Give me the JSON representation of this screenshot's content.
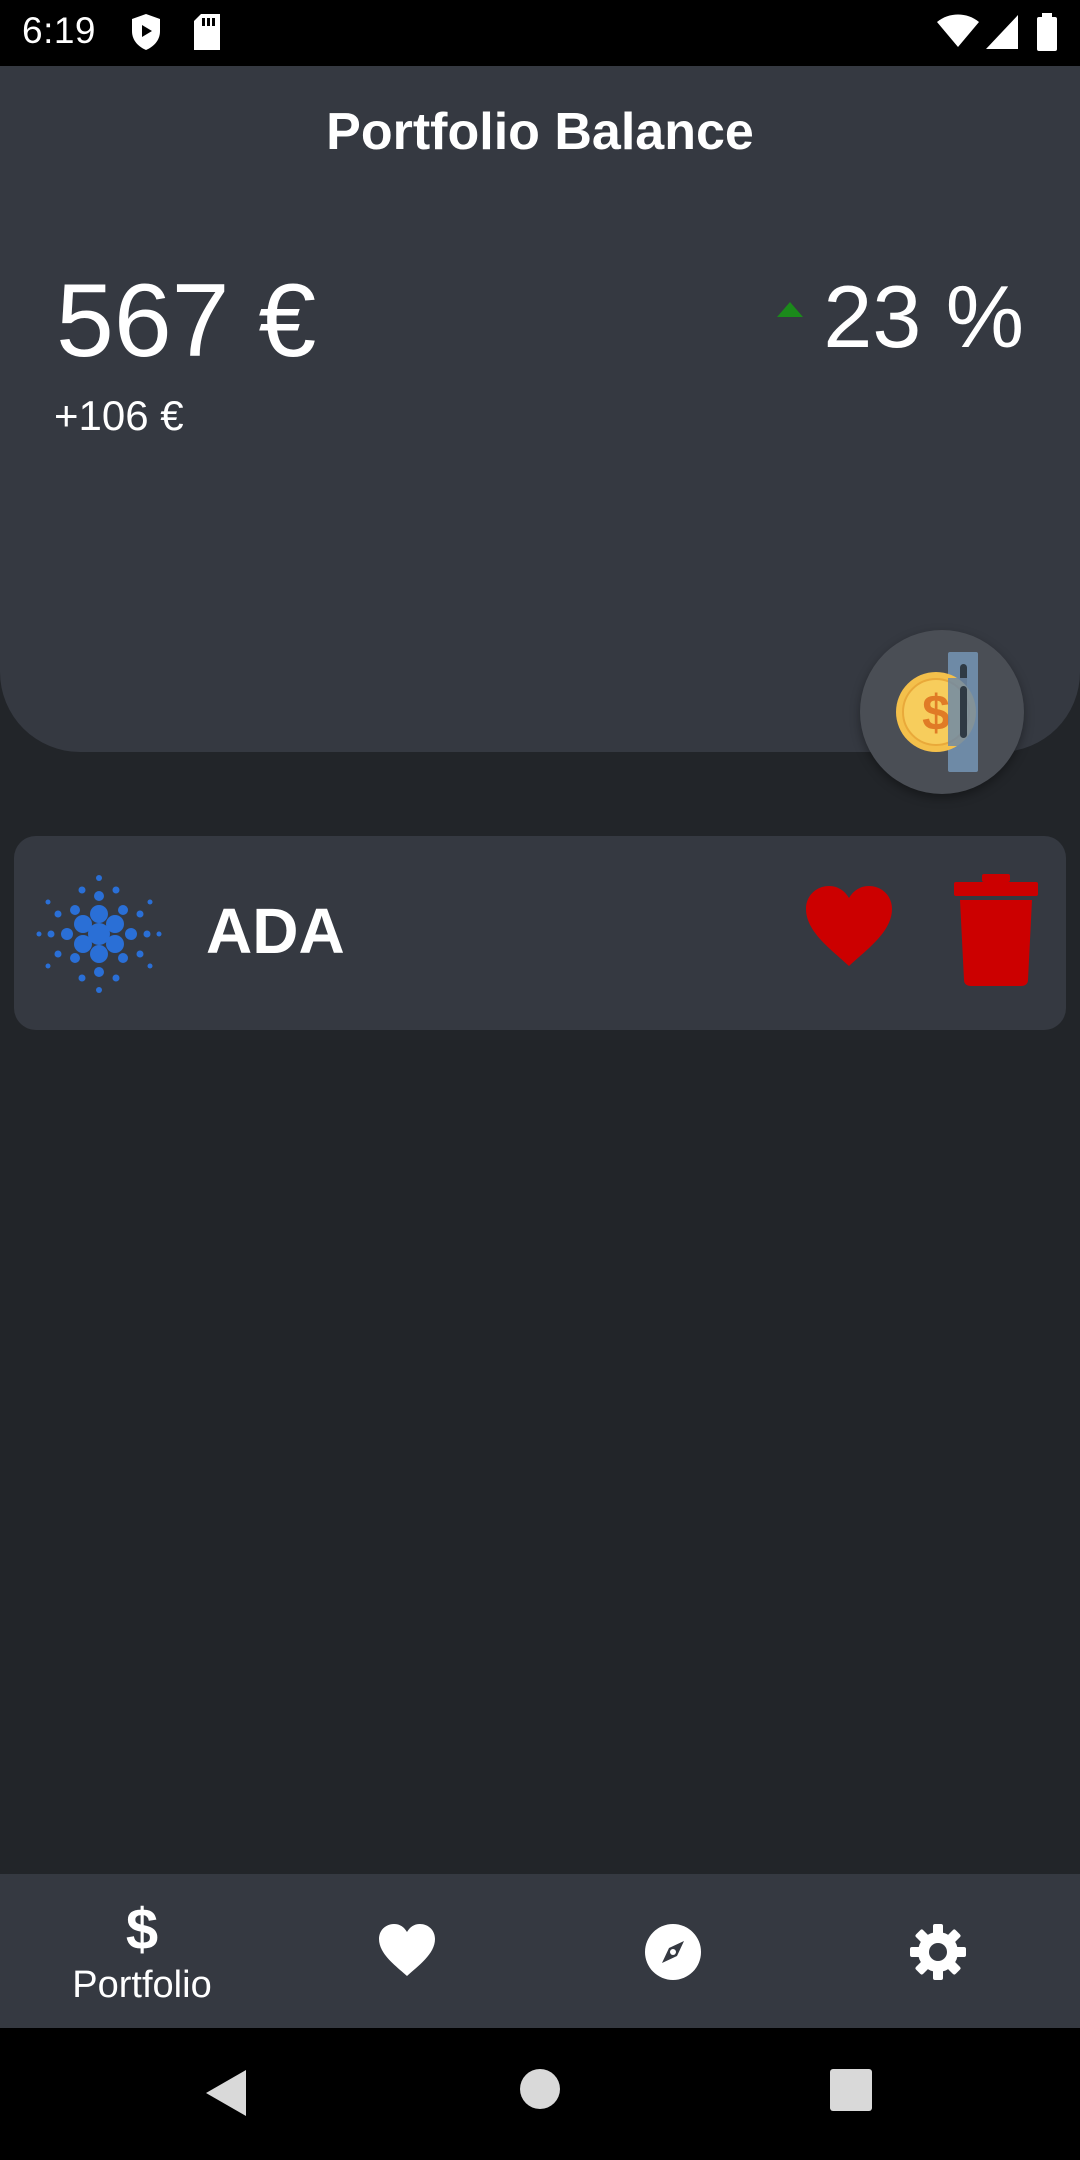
{
  "status_bar": {
    "time": "6:19",
    "icons": [
      "shield-icon",
      "sd-card-icon",
      "wifi-icon",
      "signal-icon",
      "battery-icon"
    ]
  },
  "balance_card": {
    "title": "Portfolio Balance",
    "amount": "567 €",
    "change": "+106 €",
    "percent": "23 %",
    "trend": "up",
    "trend_color": "#1b8a1b",
    "coin_button_icon": "coin-deposit-icon"
  },
  "assets": [
    {
      "symbol": "ADA",
      "logo_icon": "cardano-logo-icon",
      "logo_color": "#2a6fd6",
      "favorite_icon": "heart-icon",
      "delete_icon": "trash-icon",
      "action_color": "#cc0000"
    }
  ],
  "bottom_nav": {
    "items": [
      {
        "label": "Portfolio",
        "icon": "dollar-icon",
        "active": true
      },
      {
        "label": "",
        "icon": "heart-icon",
        "active": false
      },
      {
        "label": "",
        "icon": "compass-icon",
        "active": false
      },
      {
        "label": "",
        "icon": "gear-icon",
        "active": false
      }
    ],
    "dollar_glyph": "$"
  },
  "system_nav": [
    "back-icon",
    "home-icon",
    "recents-icon"
  ],
  "colors": {
    "background": "#222529",
    "card": "#353941",
    "accent_red": "#cc0000"
  }
}
